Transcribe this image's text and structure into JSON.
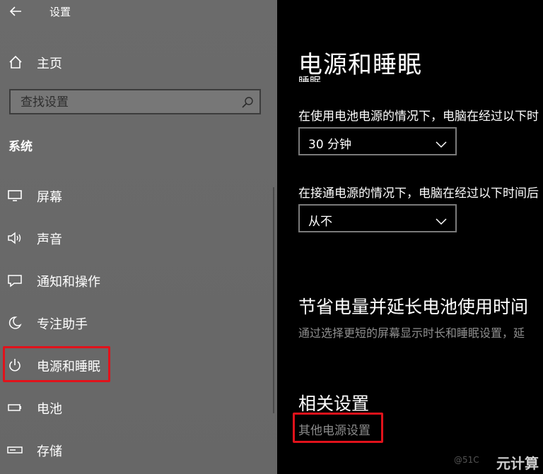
{
  "window": {
    "title": "设置"
  },
  "sidebar": {
    "home_label": "主页",
    "search_placeholder": "查找设置",
    "section_title": "系统",
    "items": [
      {
        "label": "屏幕",
        "icon": "monitor-icon"
      },
      {
        "label": "声音",
        "icon": "speaker-icon"
      },
      {
        "label": "通知和操作",
        "icon": "notification-icon"
      },
      {
        "label": "专注助手",
        "icon": "moon-icon"
      },
      {
        "label": "电源和睡眠",
        "icon": "power-icon",
        "selected": true
      },
      {
        "label": "电池",
        "icon": "battery-icon"
      },
      {
        "label": "存储",
        "icon": "storage-icon"
      }
    ]
  },
  "main": {
    "title": "电源和睡眠",
    "clipped_heading": "睡眠",
    "battery_label": "在使用电池电源的情况下，电脑在经过以下时",
    "battery_value": "30 分钟",
    "plugged_label": "在接通电源的情况下，电脑在经过以下时间后",
    "plugged_value": "从不",
    "save_heading": "节省电量并延长电池使用时间",
    "save_desc": "通过选择更短的屏幕显示时长和睡眠设置，延",
    "related_heading": "相关设置",
    "related_link": "其他电源设置"
  },
  "watermark": {
    "text": "元计算",
    "small": "@51C"
  },
  "colors": {
    "highlight": "#e1121b",
    "sidebar_bg": "#6a6a6a",
    "main_bg": "#000000"
  }
}
